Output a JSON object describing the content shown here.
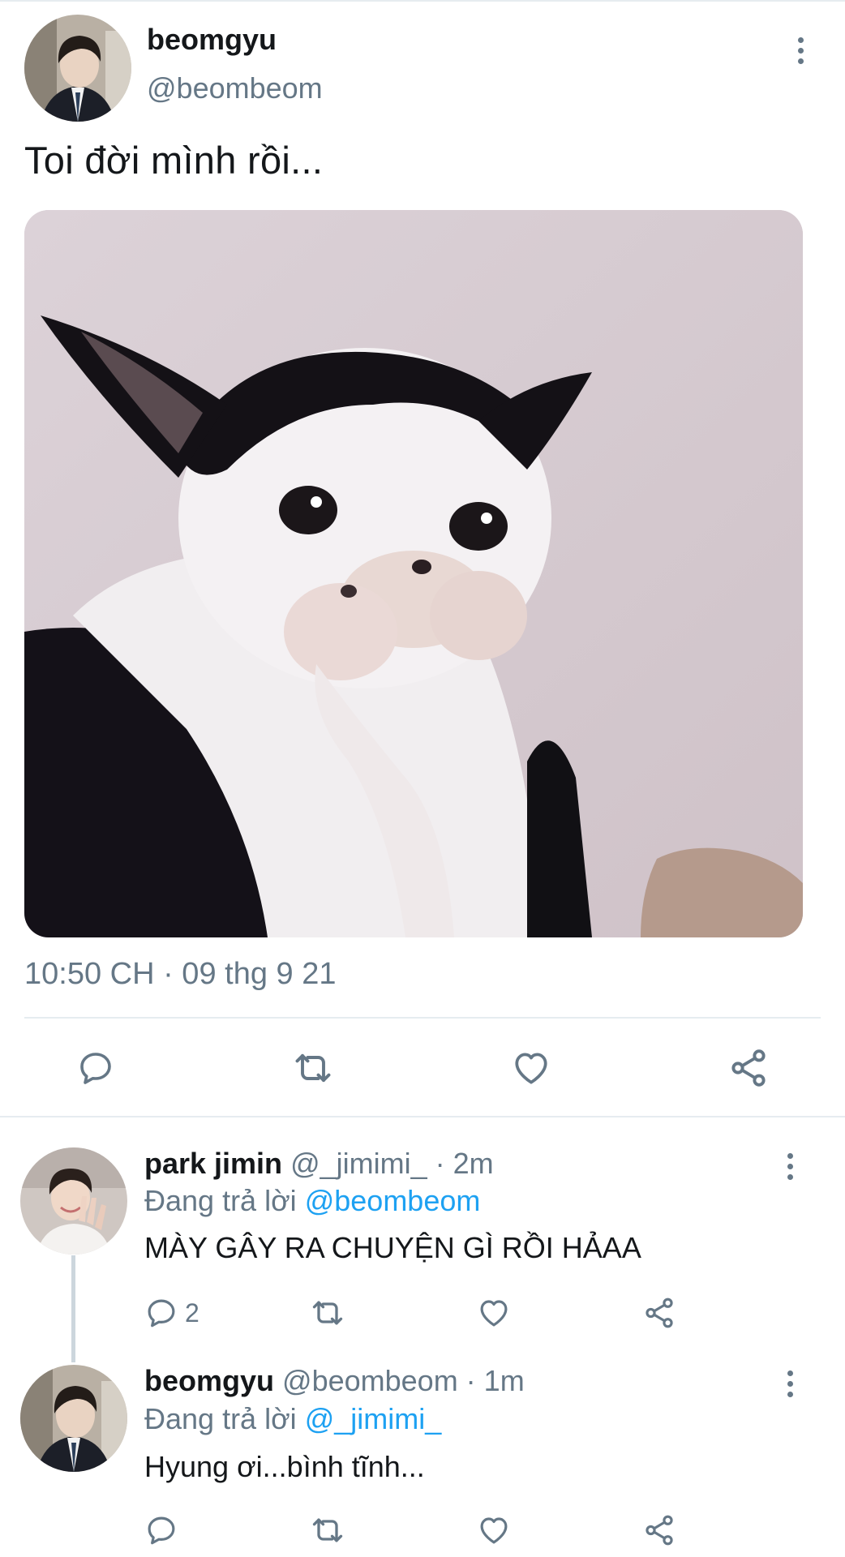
{
  "main_tweet": {
    "display_name": "beomgyu",
    "handle": "@beombeom",
    "text": "Toi đời mình rồi...",
    "timestamp": "10:50 CH · 09 thg 9 21"
  },
  "replies": [
    {
      "display_name": "park jimin",
      "meta": "@_jimimi_ · 2m",
      "replying_prefix": "Đang trả lời",
      "replying_to": "@beombeom",
      "text": "MÀY GÂY RA CHUYỆN GÌ RỒI HẢAA",
      "reply_count": "2"
    },
    {
      "display_name": "beomgyu",
      "meta": "@beombeom · 1m",
      "replying_prefix": "Đang trả lời",
      "replying_to": "@_jimimi_",
      "text": "Hyung ơi...bình tĩnh...",
      "reply_count": ""
    }
  ],
  "icons": [
    "more-vertical-icon",
    "reply-icon",
    "retweet-icon",
    "like-icon",
    "share-icon"
  ],
  "colors": {
    "text": "#14171a",
    "secondary": "#657786",
    "link": "#1da1f2",
    "divider": "#e6ecf0"
  }
}
